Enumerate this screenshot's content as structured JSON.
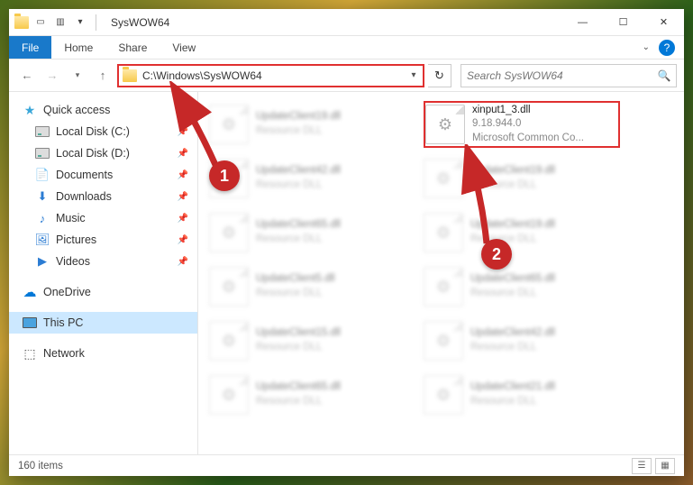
{
  "titlebar": {
    "title": "SysWOW64"
  },
  "ribbon": {
    "file": "File",
    "tabs": [
      "Home",
      "Share",
      "View"
    ]
  },
  "nav": {
    "path": "C:\\Windows\\SysWOW64",
    "search_placeholder": "Search SysWOW64"
  },
  "sidebar": {
    "quick_access": "Quick access",
    "items": [
      {
        "label": "Local Disk (C:)",
        "type": "disk"
      },
      {
        "label": "Local Disk (D:)",
        "type": "disk"
      },
      {
        "label": "Documents",
        "type": "doc"
      },
      {
        "label": "Downloads",
        "type": "down"
      },
      {
        "label": "Music",
        "type": "music"
      },
      {
        "label": "Pictures",
        "type": "pic"
      },
      {
        "label": "Videos",
        "type": "vid"
      }
    ],
    "onedrive": "OneDrive",
    "thispc": "This PC",
    "network": "Network"
  },
  "files": {
    "highlighted": {
      "name": "xinput1_3.dll",
      "version": "9.18.944.0",
      "desc": "Microsoft Common Co..."
    },
    "blurred": [
      {
        "name": "UpdateClient19.dll",
        "sub": "Resource DLL"
      },
      {
        "name": "UpdateClient42.dll",
        "sub": "Resource DLL"
      },
      {
        "name": "UpdateClient19.dll",
        "sub": "Resource DLL"
      },
      {
        "name": "UpdateClient65.dll",
        "sub": "Resource DLL"
      },
      {
        "name": "UpdateClient19.dll",
        "sub": "Resource DLL"
      },
      {
        "name": "UpdateClient5.dll",
        "sub": "Resource DLL"
      },
      {
        "name": "UpdateClient65.dll",
        "sub": "Resource DLL"
      },
      {
        "name": "UpdateClient15.dll",
        "sub": "Resource DLL"
      },
      {
        "name": "UpdateClient42.dll",
        "sub": "Resource DLL"
      },
      {
        "name": "UpdateClient65.dll",
        "sub": "Resource DLL"
      },
      {
        "name": "UpdateClient21.dll",
        "sub": "Resource DLL"
      }
    ]
  },
  "callouts": {
    "one": "1",
    "two": "2"
  },
  "status": {
    "count": "160 items"
  }
}
